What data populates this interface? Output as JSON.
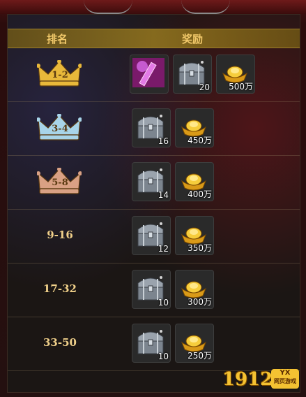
{
  "header": {
    "rank_label": "排名",
    "reward_label": "奖励"
  },
  "rows": [
    {
      "rank": "1-2",
      "crown": "gold",
      "items": [
        {
          "type": "weapon",
          "count": ""
        },
        {
          "type": "chest",
          "count": "20"
        },
        {
          "type": "ingot",
          "count": "500万"
        }
      ]
    },
    {
      "rank": "3-4",
      "crown": "silver",
      "items": [
        {
          "type": "chest",
          "count": "16"
        },
        {
          "type": "ingot",
          "count": "450万"
        }
      ]
    },
    {
      "rank": "5-8",
      "crown": "bronze",
      "items": [
        {
          "type": "chest",
          "count": "14"
        },
        {
          "type": "ingot",
          "count": "400万"
        }
      ]
    },
    {
      "rank": "9-16",
      "crown": "none",
      "items": [
        {
          "type": "chest",
          "count": "12"
        },
        {
          "type": "ingot",
          "count": "350万"
        }
      ]
    },
    {
      "rank": "17-32",
      "crown": "none",
      "items": [
        {
          "type": "chest",
          "count": "10"
        },
        {
          "type": "ingot",
          "count": "300万"
        }
      ]
    },
    {
      "rank": "33-50",
      "crown": "none",
      "items": [
        {
          "type": "chest",
          "count": "10"
        },
        {
          "type": "ingot",
          "count": "250万"
        }
      ]
    }
  ],
  "brand": {
    "number": "1912",
    "badge_top": "YX",
    "badge_sub": "网页游戏"
  },
  "colors": {
    "gold": "#e8b83a",
    "silver": "#a8d4e8",
    "bronze": "#d9a184"
  }
}
